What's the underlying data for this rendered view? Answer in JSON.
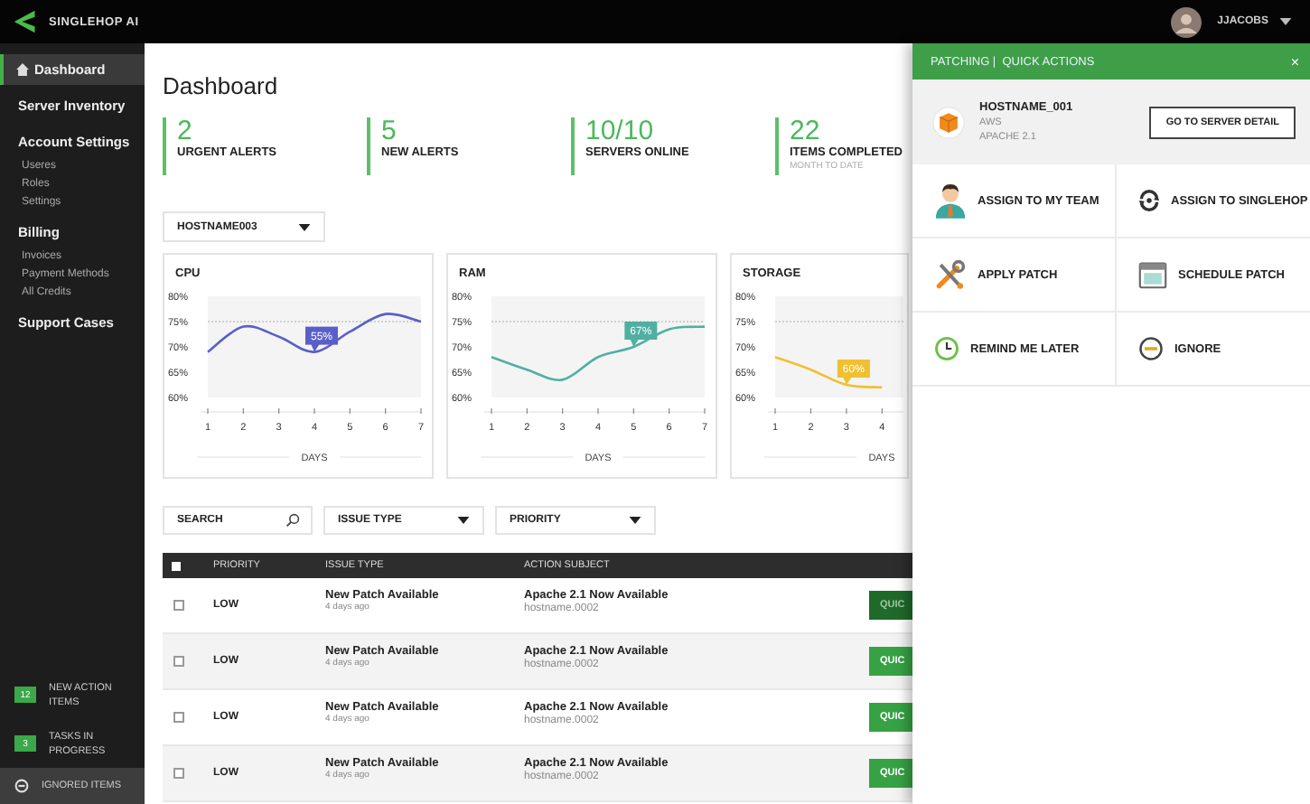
{
  "topbar": {
    "logo_text": "SINGLEHOP AI",
    "user": "JJACOBS"
  },
  "sidebar": {
    "items": [
      {
        "label": "Dashboard",
        "selected": true
      },
      {
        "label": "Server Inventory",
        "selected": false
      },
      {
        "label": "Account Settings",
        "selected": false,
        "children": [
          {
            "label": "Useres",
            "selected": false
          },
          {
            "label": "Roles",
            "selected": false
          },
          {
            "label": "Settings",
            "selected": false
          }
        ]
      },
      {
        "label": "Billing",
        "selected": false,
        "children": [
          {
            "label": "Invoices",
            "selected": false
          },
          {
            "label": "Payment Methods",
            "selected": false
          },
          {
            "label": "All Credits",
            "selected": false
          }
        ]
      },
      {
        "label": "Support Cases",
        "selected": false
      }
    ],
    "footer": [
      {
        "kind": "badge",
        "badge": "12",
        "label": "NEW ACTION ITEMS"
      },
      {
        "kind": "badge",
        "badge": "3",
        "label": "TASKS IN PROGRESS"
      },
      {
        "kind": "ignored",
        "label": "IGNORED ITEMS"
      }
    ]
  },
  "page_title": "Dashboard",
  "stats": [
    {
      "value": "2",
      "label": "URGENT ALERTS"
    },
    {
      "value": "5",
      "label": "NEW ALERTS"
    },
    {
      "value": "10/10",
      "label": "SERVERS ONLINE"
    },
    {
      "value": "22",
      "label": "ITEMS COMPLETED",
      "sublabel": "MONTH TO DATE"
    }
  ],
  "host_select": {
    "value": "HOSTNAME003"
  },
  "charts": [
    {
      "chart_data": {
        "type": "line",
        "title": "CPU",
        "xlabel": "DAYS",
        "x": [
          1,
          2,
          3,
          4,
          5,
          6,
          7
        ],
        "xlim": [
          1,
          7
        ],
        "xticks": [
          1,
          2,
          3,
          4,
          5,
          6,
          7
        ],
        "ylim": [
          60,
          80
        ],
        "yticks": [
          {
            "value": 80,
            "label": "80%"
          },
          {
            "value": 75,
            "label": "75%"
          },
          {
            "value": 70,
            "label": "70%"
          },
          {
            "value": 65,
            "label": "65%"
          },
          {
            "value": 60,
            "label": "60%"
          }
        ],
        "series": [
          {
            "color": "#5a5fc8",
            "values": [
              69,
              74,
              72,
              69,
              73,
              76.5,
              75
            ]
          }
        ],
        "annotations": [
          {
            "text": "55%",
            "x": 4,
            "y": 69
          }
        ]
      }
    },
    {
      "chart_data": {
        "type": "line",
        "title": "RAM",
        "xlabel": "DAYS",
        "x": [
          1,
          2,
          3,
          4,
          5,
          6,
          7
        ],
        "xlim": [
          1,
          7
        ],
        "xticks": [
          1,
          2,
          3,
          4,
          5,
          6,
          7
        ],
        "ylim": [
          60,
          80
        ],
        "yticks": [
          {
            "value": 80,
            "label": "80%"
          },
          {
            "value": 75,
            "label": "75%"
          },
          {
            "value": 70,
            "label": "70%"
          },
          {
            "value": 65,
            "label": "65%"
          },
          {
            "value": 60,
            "label": "60%"
          }
        ],
        "series": [
          {
            "color": "#4fb0a2",
            "values": [
              68,
              65.5,
              63.5,
              68,
              70,
              73.5,
              74
            ]
          }
        ],
        "annotations": [
          {
            "text": "67%",
            "x": 5,
            "y": 70
          }
        ]
      }
    },
    {
      "chart_data": {
        "type": "line",
        "title": "STORAGE",
        "xlabel": "DAYS",
        "x": [
          1,
          2,
          3,
          4
        ],
        "xlim": [
          1,
          4.6
        ],
        "xticks": [
          1,
          2,
          3,
          4
        ],
        "ylim": [
          60,
          80
        ],
        "yticks": [
          {
            "value": 80,
            "label": "80%"
          },
          {
            "value": 75,
            "label": "75%"
          },
          {
            "value": 70,
            "label": "70%"
          },
          {
            "value": 65,
            "label": "65%"
          },
          {
            "value": 60,
            "label": "60%"
          }
        ],
        "series": [
          {
            "color": "#f0c030",
            "values": [
              68,
              65.5,
              62.5,
              62
            ]
          }
        ],
        "annotations": [
          {
            "text": "60%",
            "x": 3,
            "y": 62.5
          }
        ]
      }
    }
  ],
  "filters": {
    "search": {
      "placeholder": "SEARCH"
    },
    "dropdowns": [
      {
        "value": "ISSUE TYPE"
      },
      {
        "value": "PRIORITY"
      }
    ]
  },
  "table": {
    "select_all": {
      "checked": false
    },
    "columns": [
      "PRIORITY",
      "ISSUE TYPE",
      "ACTION SUBJECT"
    ],
    "rows": [
      {
        "checked": false,
        "hovered": true,
        "priority": "LOW",
        "issue": "New Patch Available",
        "age": "4 days ago",
        "subject": "Apache 2.1 Now Available",
        "host": "hostname.0002",
        "action": "QUIC"
      },
      {
        "checked": false,
        "hovered": false,
        "priority": "LOW",
        "issue": "New Patch Available",
        "age": "4 days ago",
        "subject": "Apache 2.1 Now Available",
        "host": "hostname.0002",
        "action": "QUIC"
      },
      {
        "checked": false,
        "hovered": false,
        "priority": "LOW",
        "issue": "New Patch Available",
        "age": "4 days ago",
        "subject": "Apache 2.1 Now Available",
        "host": "hostname.0002",
        "action": "QUIC"
      },
      {
        "checked": false,
        "hovered": false,
        "priority": "LOW",
        "issue": "New Patch Available",
        "age": "4 days ago",
        "subject": "Apache 2.1 Now Available",
        "host": "hostname.0002",
        "action": "QUIC"
      }
    ]
  },
  "panel": {
    "title": "PATCHING |  QUICK ACTIONS",
    "close": "×",
    "server": {
      "name": "HOSTNAME_001",
      "provider": "AWS",
      "software": "APACHE 2.1",
      "button": "GO TO SERVER DETAIL"
    },
    "actions": [
      {
        "kind": "person",
        "label": "ASSIGN TO MY TEAM"
      },
      {
        "kind": "sync",
        "label": "ASSIGN TO SINGLEHOP"
      },
      {
        "kind": "tools",
        "label": "APPLY PATCH"
      },
      {
        "kind": "calendar",
        "label": "SCHEDULE PATCH"
      },
      {
        "kind": "clock",
        "label": "REMIND ME LATER"
      },
      {
        "kind": "minus",
        "label": "IGNORE"
      }
    ]
  }
}
